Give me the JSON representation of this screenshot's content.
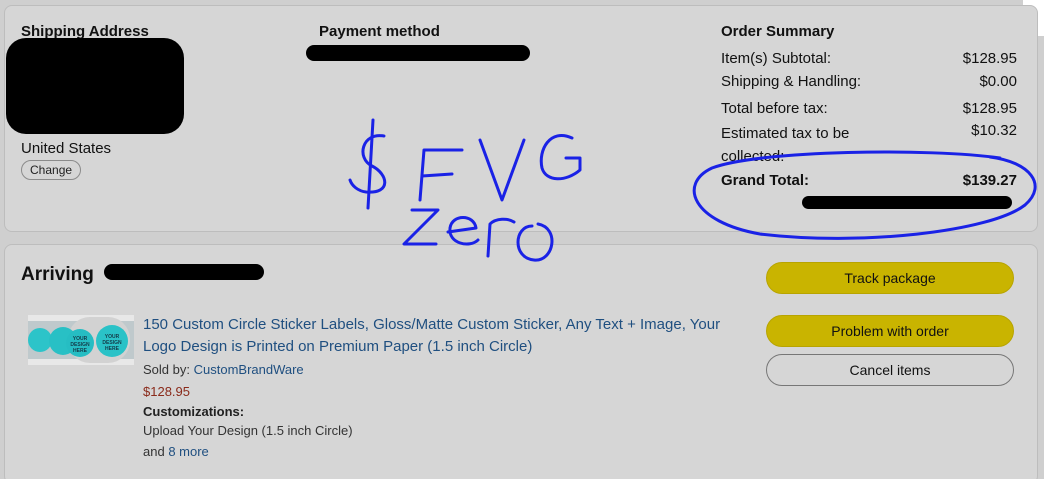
{
  "shipping": {
    "heading": "Shipping Address",
    "country": "United States",
    "change_label": "Change"
  },
  "payment": {
    "heading": "Payment method"
  },
  "summary": {
    "heading": "Order Summary",
    "rows": [
      {
        "label": "Item(s) Subtotal:",
        "value": "$128.95"
      },
      {
        "label": "Shipping & Handling:",
        "value": "$0.00"
      },
      {
        "label": "Total before tax:",
        "value": "$128.95"
      },
      {
        "label": "Estimated tax to be collected:",
        "value": "$10.32"
      }
    ],
    "grand_label": "Grand Total:",
    "grand_value": "$139.27"
  },
  "shipment": {
    "arriving_label": "Arriving",
    "product_title": "150 Custom Circle Sticker Labels, Gloss/Matte Custom Sticker, Any Text + Image, Your Logo Design is Printed on Premium Paper (1.5 inch Circle)",
    "sold_by_label": "Sold by:",
    "seller": "CustomBrandWare",
    "price": "$128.95",
    "customizations_label": "Customizations:",
    "customization_value": "Upload Your Design (1.5 inch Circle)",
    "and_label": "and",
    "more_link": "8 more",
    "image_sticker_text": "YOUR DESIGN HERE"
  },
  "actions": {
    "track": "Track package",
    "problem": "Problem with order",
    "cancel": "Cancel items"
  },
  "annotation": {
    "line1": "$FVG",
    "line2": "Zero",
    "ink_color": "#1a22e6"
  },
  "colors": {
    "button_yellow": "#c9b400",
    "link_blue": "#1f4f80",
    "price_red": "#8a2a1a"
  }
}
